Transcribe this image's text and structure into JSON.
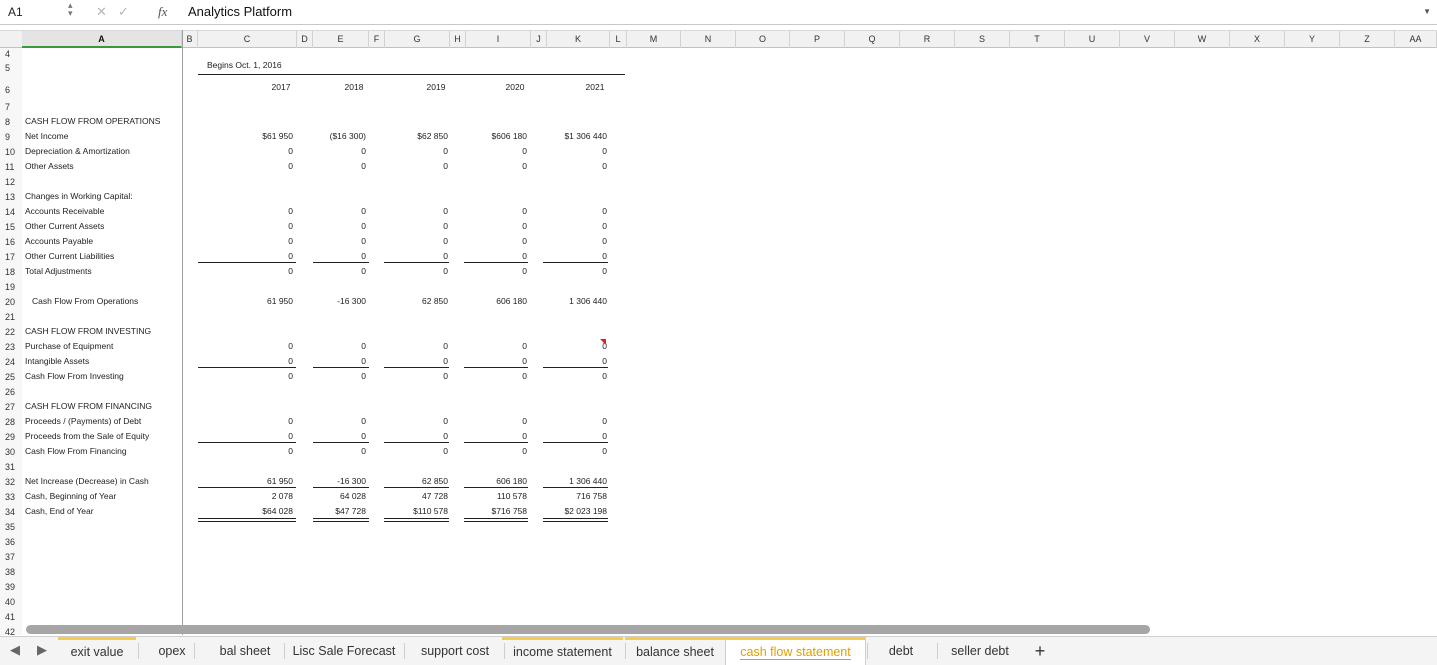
{
  "formula_bar": {
    "cell_ref": "A1",
    "cancel_icon": "✕",
    "confirm_icon": "✓",
    "fx_label": "fx",
    "value": "Analytics Platform"
  },
  "columns": [
    "A",
    "B",
    "C",
    "D",
    "E",
    "F",
    "G",
    "H",
    "I",
    "J",
    "K",
    "L",
    "M",
    "N",
    "O",
    "P",
    "Q",
    "R",
    "S",
    "T",
    "U",
    "V",
    "W",
    "X",
    "Y",
    "Z",
    "AA"
  ],
  "rows": [
    "4",
    "5",
    "6",
    "7",
    "8",
    "9",
    "10",
    "11",
    "12",
    "13",
    "14",
    "15",
    "16",
    "17",
    "18",
    "19",
    "20",
    "21",
    "22",
    "23",
    "24",
    "25",
    "26",
    "27",
    "28",
    "29",
    "30",
    "31",
    "32",
    "33",
    "34",
    "35",
    "36",
    "37",
    "38",
    "39",
    "40",
    "41",
    "42"
  ],
  "header": {
    "begins": "Begins Oct. 1, 2016",
    "years": [
      "2017",
      "2018",
      "2019",
      "2020",
      "2021"
    ]
  },
  "sections": {
    "ops": "CASH FLOW FROM OPERATIONS",
    "net_income": {
      "label": "Net Income",
      "values": [
        "$61 950",
        "($16 300)",
        "$62 850",
        "$606 180",
        "$1 306 440"
      ]
    },
    "dep": {
      "label": "Depreciation & Amortization",
      "values": [
        "0",
        "0",
        "0",
        "0",
        "0"
      ]
    },
    "other_assets": {
      "label": "Other Assets",
      "values": [
        "0",
        "0",
        "0",
        "0",
        "0"
      ]
    },
    "wc": "Changes in Working Capital:",
    "ar": {
      "label": "Accounts Receivable",
      "values": [
        "0",
        "0",
        "0",
        "0",
        "0"
      ]
    },
    "oca": {
      "label": "Other Current Assets",
      "values": [
        "0",
        "0",
        "0",
        "0",
        "0"
      ]
    },
    "ap": {
      "label": "Accounts Payable",
      "values": [
        "0",
        "0",
        "0",
        "0",
        "0"
      ]
    },
    "ocl": {
      "label": "Other Current Liabilities",
      "values": [
        "0",
        "0",
        "0",
        "0",
        "0"
      ]
    },
    "total_adj": {
      "label": "Total Adjustments",
      "values": [
        "0",
        "0",
        "0",
        "0",
        "0"
      ]
    },
    "cfo": {
      "label": "Cash Flow From Operations",
      "values": [
        "61 950",
        "-16 300",
        "62 850",
        "606 180",
        "1 306 440"
      ]
    },
    "inv": "CASH FLOW FROM INVESTING",
    "equip": {
      "label": "Purchase of Equipment",
      "values": [
        "0",
        "0",
        "0",
        "0",
        "0"
      ]
    },
    "intang": {
      "label": "Intangible Assets",
      "values": [
        "0",
        "0",
        "0",
        "0",
        "0"
      ]
    },
    "cfi": {
      "label": "Cash Flow From Investing",
      "values": [
        "0",
        "0",
        "0",
        "0",
        "0"
      ]
    },
    "fin": "CASH FLOW FROM FINANCING",
    "debt": {
      "label": "Proceeds / (Payments) of Debt",
      "values": [
        "0",
        "0",
        "0",
        "0",
        "0"
      ]
    },
    "equity": {
      "label": "Proceeds from the Sale of Equity",
      "values": [
        "0",
        "0",
        "0",
        "0",
        "0"
      ]
    },
    "cff": {
      "label": "Cash Flow From Financing",
      "values": [
        "0",
        "0",
        "0",
        "0",
        "0"
      ]
    },
    "net_inc": {
      "label": "Net Increase (Decrease) in Cash",
      "values": [
        "61 950",
        "-16 300",
        "62 850",
        "606 180",
        "1 306 440"
      ]
    },
    "cash_begin": {
      "label": "Cash, Beginning of Year",
      "values": [
        "2 078",
        "64 028",
        "47 728",
        "110 578",
        "716 758"
      ]
    },
    "cash_end": {
      "label": "Cash, End of Year",
      "values": [
        "$64 028",
        "$47 728",
        "$110 578",
        "$716 758",
        "$2 023 198"
      ]
    }
  },
  "highlight_color": "#ffff00",
  "tabs": [
    "exit value",
    "opex",
    "bal sheet",
    "Lisc Sale Forecast",
    "support cost",
    "income statement",
    "balance sheet",
    "cash flow statement",
    "debt",
    "seller debt"
  ],
  "active_tab": "cash flow statement",
  "add_sheet": "+"
}
